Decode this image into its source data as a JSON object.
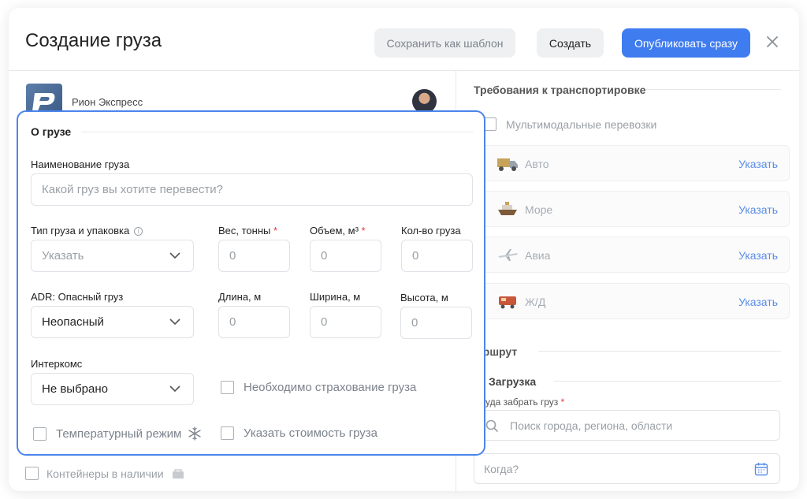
{
  "header": {
    "title": "Создание груза",
    "save_template_label": "Сохранить как шаблон",
    "create_label": "Создать",
    "publish_label": "Опубликовать сразу"
  },
  "company": {
    "name": "Рион Экспресс"
  },
  "containers_label": "Контейнеры в наличии",
  "cargo": {
    "section_title": "О грузе",
    "name_label": "Наименование груза",
    "name_placeholder": "Какой груз вы хотите перевести?",
    "type_label": "Тип груза и упаковка",
    "type_value": "Указать",
    "weight_label": "Вес, тонны",
    "volume_label": "Объем, м³",
    "quantity_label": "Кол-во груза",
    "adr_label": "ADR: Опасный груз",
    "adr_value": "Неопасный",
    "length_label": "Длина, м",
    "width_label": "Ширина, м",
    "height_label": "Высота, м",
    "intercoms_label": "Интеркомс",
    "intercoms_value": "Не выбрано",
    "insurance_label": "Необходимо страхование груза",
    "temperature_label": "Температурный режим",
    "cost_label": "Указать стоимость груза",
    "number_placeholder": "0",
    "required_mark": "*"
  },
  "transport": {
    "section_title": "Требования к транспортировке",
    "multimodal_label": "Мультимодальные перевозки",
    "set_label": "Указать",
    "modes": [
      {
        "name": "Авто",
        "icon": "truck-icon"
      },
      {
        "name": "Море",
        "icon": "ship-icon"
      },
      {
        "name": "Авиа",
        "icon": "plane-icon"
      },
      {
        "name": "Ж/Д",
        "icon": "train-icon"
      }
    ]
  },
  "route": {
    "section_title": "аршрут",
    "loading_title": "Загрузка",
    "pickup_label": "уда забрать груз",
    "search_placeholder": "Поиск города, региона, области",
    "when_placeholder": "Когда?"
  },
  "colors": {
    "accent": "#3f7cf0",
    "card_border": "#4a85ec",
    "link": "#5a8de8",
    "required": "#e0393e"
  }
}
